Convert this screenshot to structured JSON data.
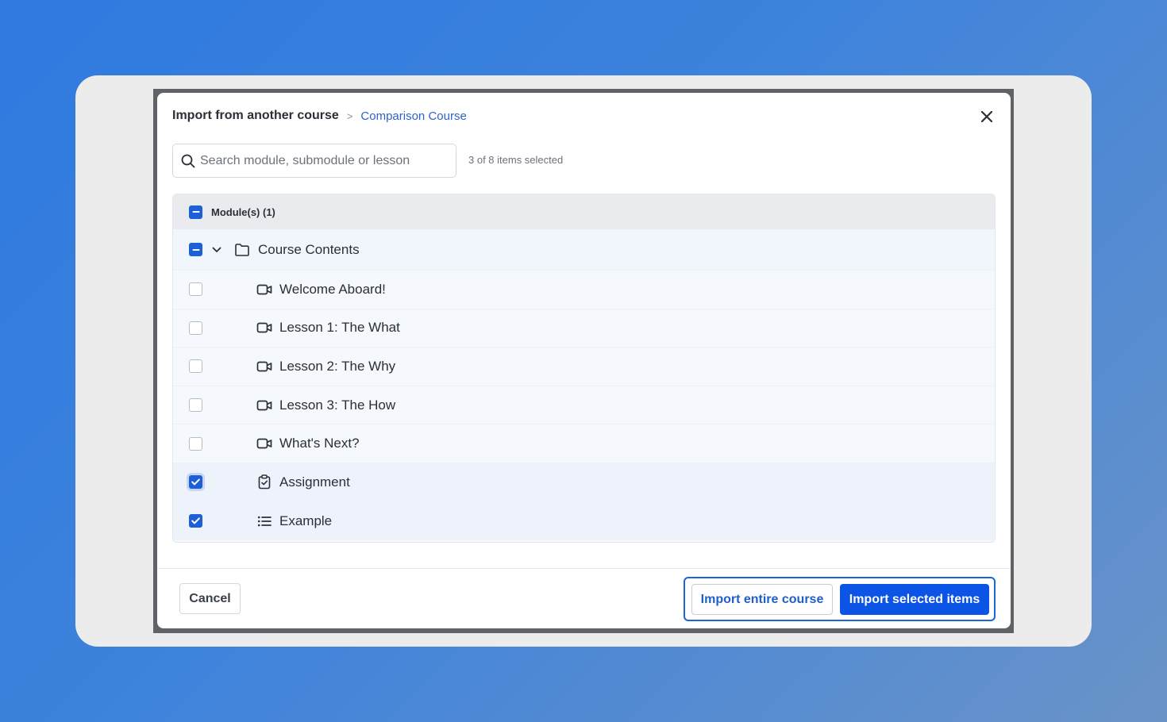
{
  "breadcrumb": {
    "root": "Import from another course",
    "separator": ">",
    "current": "Comparison Course"
  },
  "search": {
    "placeholder": "Search module, submodule or lesson",
    "value": ""
  },
  "selection_status": "3 of 8 items selected",
  "tree": {
    "header_label": "Module(s) (1)",
    "header_state": "partial",
    "module": {
      "label": "Course Contents",
      "state": "partial",
      "expanded": true,
      "icon": "folder-icon"
    },
    "items": [
      {
        "label": "Welcome Aboard!",
        "icon": "video-icon",
        "checked": false
      },
      {
        "label": "Lesson 1: The What",
        "icon": "video-icon",
        "checked": false
      },
      {
        "label": "Lesson 2: The Why",
        "icon": "video-icon",
        "checked": false
      },
      {
        "label": "Lesson 3: The How",
        "icon": "video-icon",
        "checked": false
      },
      {
        "label": "What's Next?",
        "icon": "video-icon",
        "checked": false
      },
      {
        "label": "Assignment",
        "icon": "clipboard-check-icon",
        "checked": true
      },
      {
        "label": "Example",
        "icon": "list-icon",
        "checked": true
      }
    ]
  },
  "footer": {
    "cancel_label": "Cancel",
    "import_entire_label": "Import entire course",
    "import_selected_label": "Import selected items"
  },
  "colors": {
    "accent": "#0c54e6",
    "checkbox": "#1c5fd6",
    "link": "#2d63c8",
    "background_gradient_start": "#2f7ae0",
    "background_gradient_end": "#6a93c8"
  }
}
